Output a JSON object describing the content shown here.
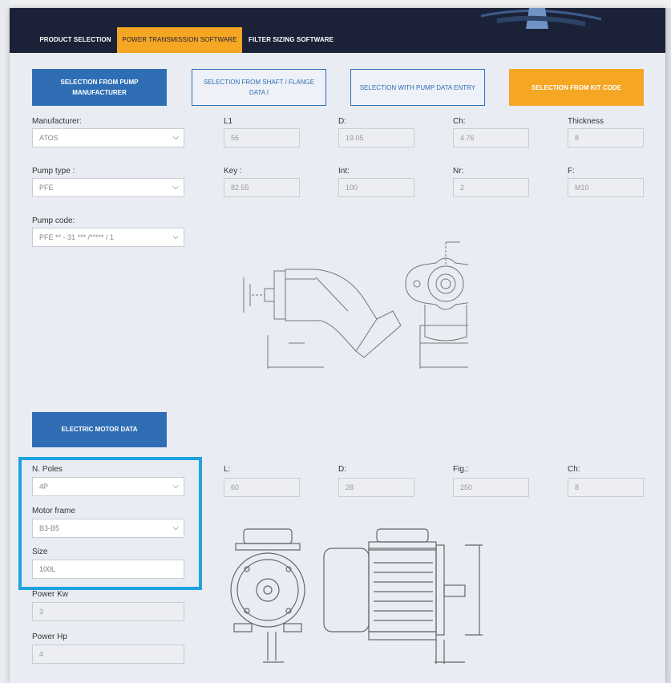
{
  "nav": {
    "tabs": [
      {
        "label": "PRODUCT SELECTION"
      },
      {
        "label": "POWER TRANSMISSION SOFTWARE"
      },
      {
        "label": "FILTER SIZING SOFTWARE"
      }
    ]
  },
  "selection_buttons": {
    "pump_manufacturer": "SELECTION FROM PUMP MANUFACTURER",
    "shaft_flange": "SELECTION FROM SHAFT / FLANGE DATA I",
    "pump_data_entry": "SELECTION WITH PUMP DATA ENTRY",
    "kit_code": "SELECTION FROM KIT CODE"
  },
  "pump": {
    "manufacturer_label": "Manufacturer:",
    "manufacturer_value": "ATOS",
    "pump_type_label": "Pump type :",
    "pump_type_value": "PFE",
    "pump_code_label": "Pump code:",
    "pump_code_value": "PFE ** - 31 *** /***** / 1",
    "fields": {
      "l1_label": "L1",
      "l1_value": "56",
      "d_label": "D:",
      "d_value": "19.05",
      "ch_label": "Ch:",
      "ch_value": "4.76",
      "thickness_label": "Thickness",
      "thickness_value": "8",
      "key_label": "Key :",
      "key_value": "82.55",
      "int_label": "Int:",
      "int_value": "100",
      "nr_label": "Nr:",
      "nr_value": "2",
      "f_label": "F:",
      "f_value": "M10"
    }
  },
  "motor": {
    "tab_label": "ELECTRIC MOTOR DATA",
    "poles_label": "N. Poles",
    "poles_value": "4P",
    "frame_label": "Motor frame",
    "frame_value": "B3-B5",
    "size_label": "Size",
    "size_value": "100L",
    "power_kw_label": "Power Kw",
    "power_kw_value": "3",
    "power_hp_label": "Power Hp",
    "power_hp_value": "4",
    "fields": {
      "l_label": "L:",
      "l_value": "60",
      "d_label": "D:",
      "d_value": "28",
      "fig_label": "Fig.:",
      "fig_value": "250",
      "ch_label": "Ch:",
      "ch_value": "8"
    }
  },
  "icons": {
    "chevron": "chevron-down-icon",
    "chevron_glyph": "⌵"
  },
  "colors": {
    "navbar": "#1b2238",
    "accent_orange": "#f5a623",
    "primary_blue": "#2f6db5",
    "highlight": "#1fa2e0"
  }
}
